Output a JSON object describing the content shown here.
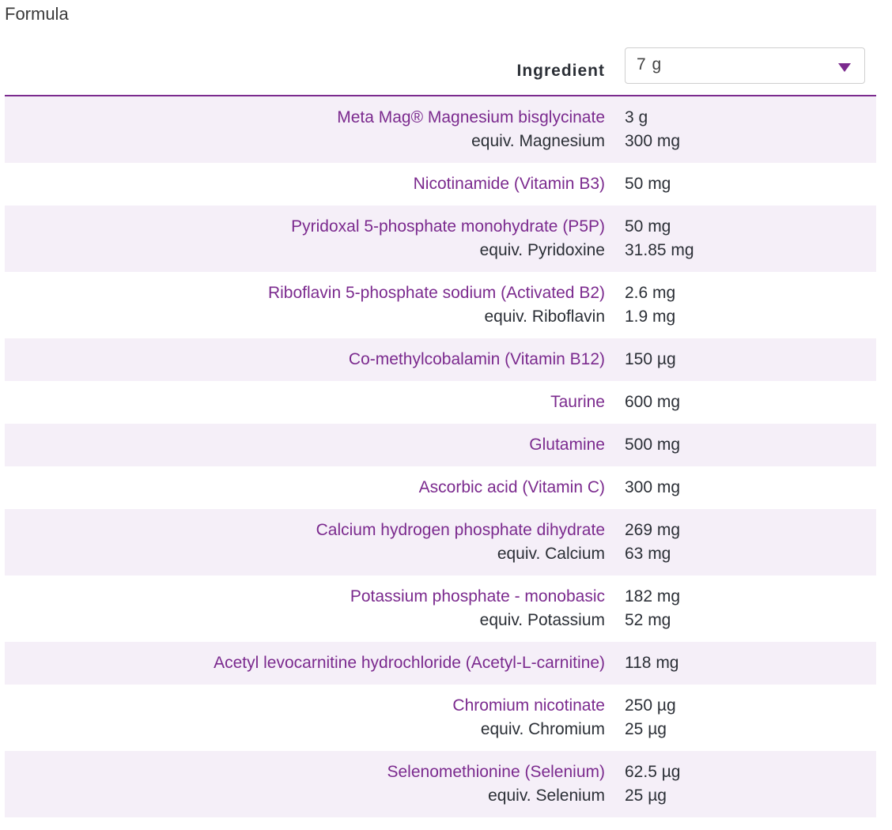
{
  "title": "Formula",
  "header": {
    "column_label": "Ingredient",
    "dose_select": {
      "value": "7 g"
    }
  },
  "rows": [
    {
      "name": "Meta Mag® Magnesium bisglycinate",
      "amount": "3 g",
      "equiv_name": "equiv. Magnesium",
      "equiv_amount": "300 mg"
    },
    {
      "name": "Nicotinamide (Vitamin B3)",
      "amount": "50 mg"
    },
    {
      "name": "Pyridoxal 5-phosphate monohydrate (P5P)",
      "amount": "50 mg",
      "equiv_name": "equiv. Pyridoxine",
      "equiv_amount": "31.85 mg"
    },
    {
      "name": "Riboflavin 5-phosphate sodium (Activated B2)",
      "amount": "2.6 mg",
      "equiv_name": "equiv. Riboflavin",
      "equiv_amount": "1.9 mg"
    },
    {
      "name": "Co-methylcobalamin (Vitamin B12)",
      "amount": "150 µg"
    },
    {
      "name": "Taurine",
      "amount": "600 mg"
    },
    {
      "name": "Glutamine",
      "amount": "500 mg"
    },
    {
      "name": "Ascorbic acid (Vitamin C)",
      "amount": "300 mg"
    },
    {
      "name": "Calcium hydrogen phosphate dihydrate",
      "amount": "269 mg",
      "equiv_name": "equiv. Calcium",
      "equiv_amount": "63 mg"
    },
    {
      "name": "Potassium phosphate - monobasic",
      "amount": "182 mg",
      "equiv_name": "equiv. Potassium",
      "equiv_amount": "52 mg"
    },
    {
      "name": "Acetyl levocarnitine hydrochloride (Acetyl-L-carnitine)",
      "amount": "118 mg"
    },
    {
      "name": "Chromium nicotinate",
      "amount": "250 µg",
      "equiv_name": "equiv. Chromium",
      "equiv_amount": "25 µg"
    },
    {
      "name": "Selenomethionine (Selenium)",
      "amount": "62.5 µg",
      "equiv_name": "equiv. Selenium",
      "equiv_amount": "25 µg"
    }
  ],
  "colors": {
    "accent": "#7b2a8e",
    "row_shade": "#f5eff8",
    "text": "#2b2f36"
  },
  "icons": {
    "dose_select_caret": "caret-down-icon"
  }
}
